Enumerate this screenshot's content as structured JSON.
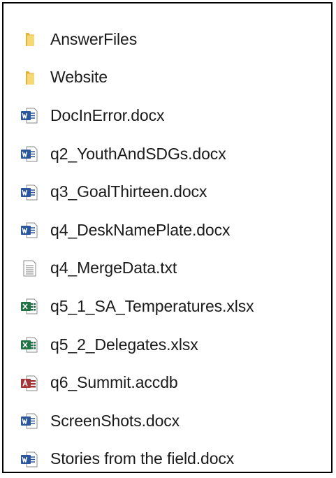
{
  "files": [
    {
      "name": "AnswerFiles",
      "icon": "folder-icon"
    },
    {
      "name": "Website",
      "icon": "folder-icon"
    },
    {
      "name": "DocInError.docx",
      "icon": "word-icon"
    },
    {
      "name": "q2_YouthAndSDGs.docx",
      "icon": "word-icon"
    },
    {
      "name": "q3_GoalThirteen.docx",
      "icon": "word-icon"
    },
    {
      "name": "q4_DeskNamePlate.docx",
      "icon": "word-icon"
    },
    {
      "name": "q4_MergeData.txt",
      "icon": "text-file-icon"
    },
    {
      "name": "q5_1_SA_Temperatures.xlsx",
      "icon": "excel-icon"
    },
    {
      "name": "q5_2_Delegates.xlsx",
      "icon": "excel-icon"
    },
    {
      "name": "q6_Summit.accdb",
      "icon": "access-icon"
    },
    {
      "name": "ScreenShots.docx",
      "icon": "word-icon"
    },
    {
      "name": "Stories from the field.docx",
      "icon": "word-icon"
    }
  ],
  "colors": {
    "folder": "#f8d775",
    "word": "#2b579a",
    "excel": "#217346",
    "access": "#a4373a"
  }
}
